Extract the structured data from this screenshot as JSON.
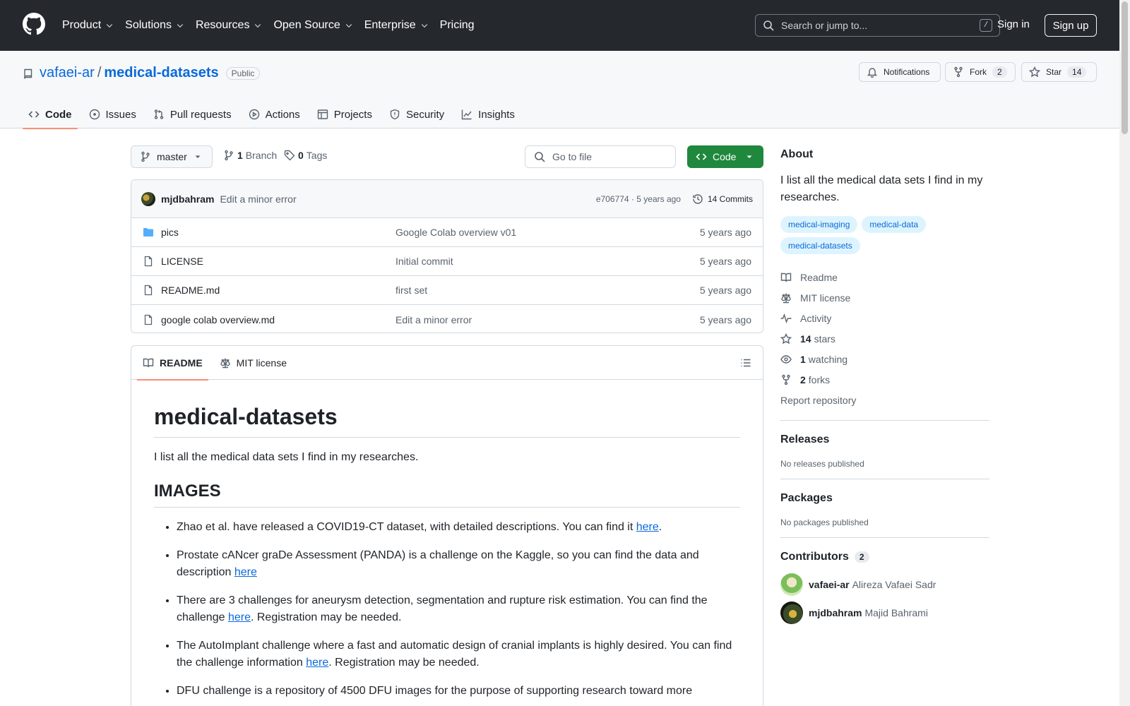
{
  "header": {
    "nav": [
      "Product",
      "Solutions",
      "Resources",
      "Open Source",
      "Enterprise",
      "Pricing"
    ],
    "search_placeholder": "Search or jump to...",
    "search_key": "/",
    "sign_in": "Sign in",
    "sign_up": "Sign up"
  },
  "repo": {
    "owner": "vafaei-ar",
    "separator": "/",
    "name": "medical-datasets",
    "visibility": "Public",
    "notifications_label": "Notifications",
    "fork_label": "Fork",
    "fork_count": "2",
    "star_label": "Star",
    "star_count": "14"
  },
  "tabs": [
    "Code",
    "Issues",
    "Pull requests",
    "Actions",
    "Projects",
    "Security",
    "Insights"
  ],
  "toolbar": {
    "branch": "master",
    "branch_count": "1",
    "branch_label": "Branch",
    "tag_count": "0",
    "tag_label": "Tags",
    "goto_placeholder": "Go to file",
    "code_label": "Code"
  },
  "commit": {
    "author": "mjdbahram",
    "message": "Edit a minor error",
    "sha_age": "e706774 · 5 years ago",
    "commits": "14 Commits"
  },
  "files": [
    {
      "name": "pics",
      "message": "Google Colab overview v01",
      "age": "5 years ago",
      "type": "folder"
    },
    {
      "name": "LICENSE",
      "message": "Initial commit",
      "age": "5 years ago",
      "type": "file"
    },
    {
      "name": "README.md",
      "message": "first set",
      "age": "5 years ago",
      "type": "file"
    },
    {
      "name": "google colab overview.md",
      "message": "Edit a minor error",
      "age": "5 years ago",
      "type": "file"
    }
  ],
  "readme": {
    "tab_readme": "README",
    "tab_license": "MIT license",
    "title": "medical-datasets",
    "intro": "I list all the medical data sets I find in my researches.",
    "section": "IMAGES",
    "items": [
      {
        "pre": "Zhao et al. have released a COVID19-CT dataset, with detailed descriptions. You can find it ",
        "link": "here",
        "post": "."
      },
      {
        "pre": "Prostate cANcer graDe Assessment (PANDA) is a challenge on the Kaggle, so you can find the data and description ",
        "link": "here",
        "post": ""
      },
      {
        "pre": "There are 3 challenges for aneurysm detection, segmentation and rupture risk estimation. You can find the challenge ",
        "link": "here",
        "post": ". Registration may be needed."
      },
      {
        "pre": "The AutoImplant challenge where a fast and automatic design of cranial implants is highly desired. You can find the challenge information ",
        "link": "here",
        "post": ". Registration may be needed."
      },
      {
        "pre": "DFU challenge is a repository of 4500 DFU images for the purpose of supporting research toward more",
        "link": "",
        "post": ""
      }
    ]
  },
  "about": {
    "title": "About",
    "description": "I list all the medical data sets I find in my researches.",
    "topics": [
      "medical-imaging",
      "medical-data",
      "medical-datasets"
    ],
    "readme": "Readme",
    "license": "MIT license",
    "activity": "Activity",
    "stars_count": "14",
    "stars_label": "stars",
    "watching_count": "1",
    "watching_label": "watching",
    "forks_count": "2",
    "forks_label": "forks",
    "report": "Report repository"
  },
  "releases": {
    "title": "Releases",
    "text": "No releases published"
  },
  "packages": {
    "title": "Packages",
    "text": "No packages published"
  },
  "contributors": {
    "title": "Contributors",
    "count": "2",
    "list": [
      {
        "login": "vafaei-ar",
        "name": "Alireza Vafaei Sadr"
      },
      {
        "login": "mjdbahram",
        "name": "Majid Bahrami"
      }
    ]
  },
  "colors": {
    "header_bg": "#25292e",
    "accent": "#0969da",
    "code_button": "#1f883d",
    "tab_underline": "#fd8c73"
  }
}
